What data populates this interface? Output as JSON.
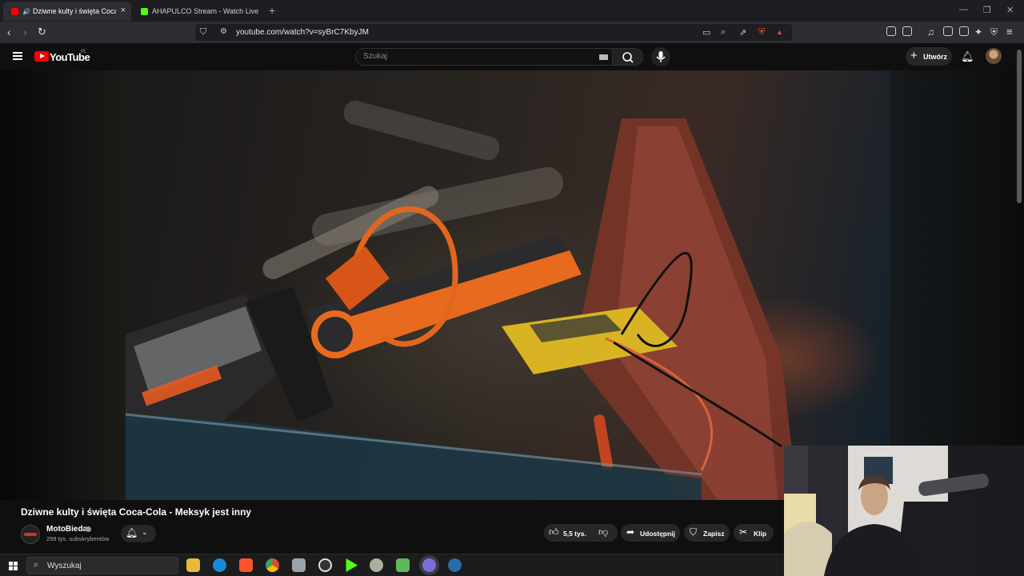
{
  "browser": {
    "tabs": [
      {
        "label": "Dziwne kulty i święta Coca-Co",
        "active": true,
        "favicon": "youtube-icon",
        "color": "#ff0000"
      },
      {
        "label": "AHAPULCO Stream - Watch Live on K",
        "active": false,
        "favicon": "kick-icon",
        "color": "#53fc18"
      }
    ],
    "url": "youtube.com/watch?v=syBrC7KbyJM"
  },
  "youtube": {
    "logo_text": "YouTube",
    "country_code": "PL",
    "search_placeholder": "Szukaj",
    "create_label": "Utwórz"
  },
  "video": {
    "title": "Dziwne kulty i święta Coca-Cola - Meksyk jest inny",
    "channel": {
      "name": "MotoBieda",
      "subscribers": "298 tys. subskrybentów"
    },
    "actions": {
      "likes": "5,5 tys.",
      "share": "Udostępnij",
      "save": "Zapisz",
      "clip": "Klip"
    }
  },
  "taskbar": {
    "search_label": "Wyszukaj",
    "apps": [
      "file-explorer-icon",
      "edge-icon",
      "brave-icon",
      "chrome-icon",
      "app-icon",
      "obs-icon",
      "kick-icon",
      "app-icon",
      "app-icon",
      "opera-icon",
      "steam-icon"
    ]
  },
  "colors": {
    "accent": "#ff0000",
    "background": "#0f0f0f",
    "surface": "#272727"
  }
}
